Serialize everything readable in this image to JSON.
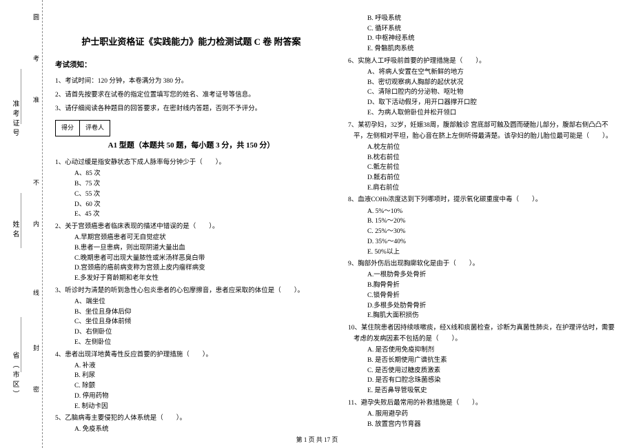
{
  "margin": {
    "vlabel1": "准考证号",
    "vlabel2": "姓名",
    "vlabel3": "省（市区）",
    "inner1": "圆",
    "inner2": "考",
    "inner3": "准",
    "inner4": "不",
    "inner5": "内",
    "inner6": "线",
    "inner7": "封",
    "inner8": "密"
  },
  "header": {
    "title": "护士职业资格证《实践能力》能力检测试题 C 卷 附答案",
    "notice_heading": "考试须知：",
    "inst1": "1、考试时间：120 分钟，本卷满分为 380 分。",
    "inst2": "2、请首先按要求在试卷的指定位置填写您的姓名、准考证号等信息。",
    "inst3": "3、请仔细阅读各种题目的回答要求，在密封线内答题，否则不予评分。"
  },
  "scorebox": {
    "cell1": "得分",
    "cell2": "评卷人"
  },
  "section_a1": {
    "heading": "A1 型题（本题共 50 题，每小题 3 分，共 150 分）"
  },
  "questions": {
    "q1": "1、心动过缓是指安静状态下成人脉率每分钟少于（　　）。",
    "q1a": "A、85 次",
    "q1b": "B、75 次",
    "q1c": "C、55 次",
    "q1d": "D、60 次",
    "q1e": "E、45 次",
    "q2": "2、关于宫颈癌患者临床表现的描述中错误的是（　　）。",
    "q2a": "A.早期宫颈癌患者可无自觉症状",
    "q2b": "B.患者一旦患病，则出现阴道大量出血",
    "q2c": "C.晚期患者可出现大量脓性或米汤样恶臭白带",
    "q2d": "D.宫颈癌的癌前病变称为宫颈上皮内瘤样病变",
    "q2e": "E.多发好于育龄期和老年女性",
    "q3": "3、听诊时为清楚的听到急性心包炎患者的心包摩擦音，患者应采取的体位是（　　）。",
    "q3a": "A、端坐位",
    "q3b": "B、坐位且身体后仰",
    "q3c": "C、坐位且身体前倾",
    "q3d": "D、右侧卧位",
    "q3e": "E、左侧卧位",
    "q4": "4、患者出现洋地黄毒性反应首要的护理措施（　　）。",
    "q4a": "A. 补液",
    "q4b": "B. 利尿",
    "q4c": "C. 除颤",
    "q4d": "D. 停用药物",
    "q4e": "E. 制动卡因",
    "q5": "5、乙脑病毒主要侵犯的人体系统是（　　）。",
    "q5a": "A. 免疫系统",
    "q5b": "B. 呼吸系统",
    "q5c": "C. 循环系统",
    "q5d": "D. 中枢神经系统",
    "q5e": "E. 骨骼肌肉系统",
    "q6": "6、实施人工呼吸前首要的护理措施是（　　）。",
    "q6a": "A、将病人安置在空气新鲜的地方",
    "q6b": "B、密切观察病人胸部的起伏状况",
    "q6c": "C、清除口腔内的分泌物、呕吐物",
    "q6d": "D、取下活动假牙，用开口器撑开口腔",
    "q6e": "E、为病人取俯卧位并松开领口",
    "q7": "7、某初孕妇，32岁，妊娠38周，腹部触诊 宫底部可触及圆而硬胎儿部分，腹部右侧凸凸不平，左侧相对平坦，胎心音在脐上左侧听得最清楚。该孕妇的胎儿胎位最可能是（　　）。",
    "q7a": "A.枕左前位",
    "q7b": "B.枕右前位",
    "q7c": "C.骶左前位",
    "q7d": "D.骶右前位",
    "q7e": "E.肩右前位",
    "q8": "8、血液COHb浓度达到下列哪项时，提示氧化碳重度中毒（　　）。",
    "q8a": "A. 5%～10%",
    "q8b": "B. 15%～20%",
    "q8c": "C. 25%～30%",
    "q8d": "D. 35%～40%",
    "q8e": "E. 50%以上",
    "q9": "9、胸部外伤后出现胸廓软化是由于（　　）。",
    "q9a": "A.一根肋骨多处骨折",
    "q9b": "B.胸骨骨折",
    "q9c": "C.锁骨骨折",
    "q9d": "D.多根多处肋骨骨折",
    "q9e": "E.胸肌大面积损伤",
    "q10": "10、某住院患者因持续咳嗽痰，经X线和痰菌检查，诊断为真菌性肺炎，在护理评估时，需要考虑的发病因素不包括的是（　　）。",
    "q10a": "A. 是否使用免疫抑制剂",
    "q10b": "B. 是否长期使用广谱抗生素",
    "q10c": "C. 是否使用过糖皮质激素",
    "q10d": "D. 是否有口腔念珠菌感染",
    "q10e": "E. 是否鼻导管吸氧史",
    "q11": "11、避孕失败后最常用的补救措施是（　　）。",
    "q11a": "A. 服用避孕药",
    "q11b": "B. 放置宫内节育器"
  },
  "footer": "第 1 页 共 17 页"
}
